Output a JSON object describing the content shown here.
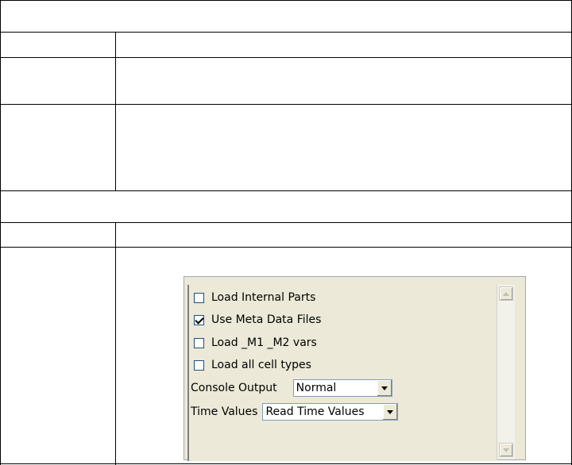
{
  "panel": {
    "checkboxes": [
      {
        "label": "Load Internal Parts",
        "checked": false
      },
      {
        "label": "Use Meta Data Files",
        "checked": true
      },
      {
        "label": "Load _M1 _M2 vars",
        "checked": false
      },
      {
        "label": "Load all cell types",
        "checked": false
      }
    ],
    "console_output": {
      "label": "Console Output",
      "value": "Normal"
    },
    "time_values": {
      "label": "Time Values",
      "value": "Read Time Values"
    }
  },
  "scrollbar": {
    "up_icon": "scroll-up-arrow",
    "down_icon": "scroll-down-arrow"
  }
}
